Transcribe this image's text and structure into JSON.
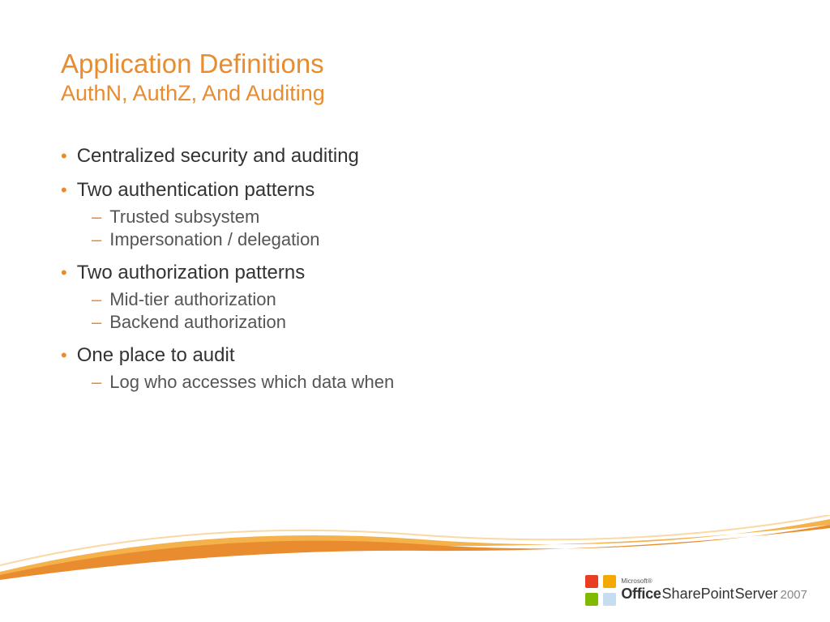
{
  "title": "Application Definitions",
  "subtitle": "AuthN, AuthZ, And Auditing",
  "content": {
    "b0": {
      "text": "Centralized security and auditing"
    },
    "b1": {
      "text": "Two authentication patterns",
      "s0": "Trusted subsystem",
      "s1": "Impersonation / delegation"
    },
    "b2": {
      "text": "Two authorization patterns",
      "s0": "Mid-tier authorization",
      "s1": "Backend authorization"
    },
    "b3": {
      "text": "One place to audit",
      "s0": "Log who accesses which data when"
    }
  },
  "product": {
    "microsoft": "Microsoft®",
    "office": "Office",
    "sharepoint": "SharePoint",
    "server": "Server",
    "year": "2007"
  }
}
